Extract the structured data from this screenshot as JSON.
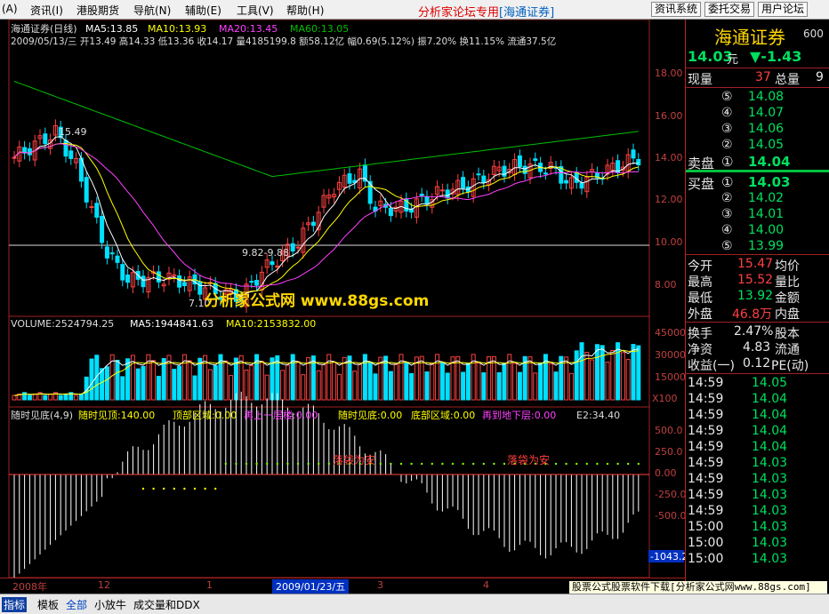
{
  "menu": {
    "items": [
      "资讯(I)",
      "港股期货",
      "导航(N)",
      "辅助(E)",
      "工具(V)",
      "帮助(H)"
    ],
    "prefix": "(A)",
    "center_title": "分析家论坛专用",
    "center_stock": "[海通证券]",
    "right_buttons": [
      "资讯系统",
      "委托交易",
      "用户论坛"
    ]
  },
  "kline": {
    "header_name": "海通证券(日线)",
    "ma5": "MA5:13.85",
    "ma10": "MA10:13.93",
    "ma20": "MA20:13.45",
    "ma60": "MA60:13.05",
    "info_line": "2009/05/13/三 开13.49 高14.33 低13.36 收14.17 量4185199.8 额58.12亿 幅0.69(5.12%) 振7.20% 换11.15% 流通37.5亿",
    "y_ticks": [
      "18.00",
      "16.00",
      "14.00",
      "12.00",
      "10.00",
      "8.00"
    ],
    "annotations": {
      "high": "15.49",
      "low": "7.10",
      "range": "9.82-9.88"
    },
    "watermark": "分析家公式网 www.88gs.com"
  },
  "volume": {
    "label": "VOLUME:2524794.25",
    "ma5": "MA5:1944841.63",
    "ma10": "MA10:2153832.00",
    "y_ticks": [
      "45000",
      "30000",
      "15000"
    ],
    "unit": "X100"
  },
  "indicator": {
    "name": "随时见底(4,9)",
    "labels": [
      "随时见顶:140.00",
      "顶部区域:0.00",
      "再上一层楼:0.00",
      "随时见底:0.00",
      "底部区域:0.00",
      "再到地下层:0.00",
      "E2:34.40"
    ],
    "y_ticks": [
      "500.0",
      "250.0",
      "0.00",
      "-250.0",
      "-500.0"
    ],
    "current": "-1043.2",
    "notes": [
      "落袋为安",
      "落袋为安"
    ]
  },
  "date_axis": {
    "labels": [
      "2008年",
      "12",
      "1",
      "3",
      "4"
    ],
    "cursor_date": "2009/01/23/五"
  },
  "quote": {
    "name": "海通证券",
    "code": "600",
    "price": "14.03",
    "unit": "元",
    "change": "▼-1.43",
    "current_vol_label": "现量",
    "current_vol": "37",
    "total_vol_label": "总量",
    "total_vol": "9",
    "sell_label": "卖盘",
    "buy_label": "买盘",
    "asks": [
      {
        "lvl": "⑤",
        "price": "14.08"
      },
      {
        "lvl": "④",
        "price": "14.07"
      },
      {
        "lvl": "③",
        "price": "14.06"
      },
      {
        "lvl": "②",
        "price": "14.05"
      },
      {
        "lvl": "①",
        "price": "14.04"
      }
    ],
    "bids": [
      {
        "lvl": "①",
        "price": "14.03"
      },
      {
        "lvl": "②",
        "price": "14.02"
      },
      {
        "lvl": "③",
        "price": "14.01"
      },
      {
        "lvl": "④",
        "price": "14.00"
      },
      {
        "lvl": "⑤",
        "price": "13.99"
      }
    ],
    "stats": [
      {
        "label": "今开",
        "value": "15.47",
        "label2": "均价"
      },
      {
        "label": "最高",
        "value": "15.52",
        "label2": "量比"
      },
      {
        "label": "最低",
        "value": "13.92",
        "label2": "金额"
      },
      {
        "label": "外盘",
        "value": "46.8万",
        "label2": "内盘"
      }
    ],
    "stats2": [
      {
        "label": "换手",
        "value": "2.47%",
        "label2": "股本"
      },
      {
        "label": "净资",
        "value": "4.83",
        "label2": "流通"
      },
      {
        "label": "收益(一)",
        "value": "0.12",
        "label2": "PE(动)"
      }
    ],
    "ticks": [
      {
        "time": "14:59",
        "price": "14.05"
      },
      {
        "time": "14:59",
        "price": "14.04"
      },
      {
        "time": "14:59",
        "price": "14.04"
      },
      {
        "time": "14:59",
        "price": "14.04"
      },
      {
        "time": "14:59",
        "price": "14.04"
      },
      {
        "time": "14:59",
        "price": "14.03"
      },
      {
        "time": "14:59",
        "price": "14.03"
      },
      {
        "time": "14:59",
        "price": "14.03"
      },
      {
        "time": "14:59",
        "price": "14.03"
      },
      {
        "time": "15:00",
        "price": "14.03"
      },
      {
        "time": "15:00",
        "price": "14.03"
      },
      {
        "time": "15:00",
        "price": "14.03"
      }
    ]
  },
  "tabs": [
    "指标",
    "模板",
    "全部",
    "小放牛",
    "成交量和DDX"
  ],
  "ad": "股票公式股票软件下载[分析家公式网www.88gs.com]",
  "colors": {
    "up": "#ff4040",
    "down": "#00e0ff",
    "ma5": "#ffffff",
    "ma10": "#ffff00",
    "ma20": "#ff40ff",
    "ma60": "#00c000"
  }
}
